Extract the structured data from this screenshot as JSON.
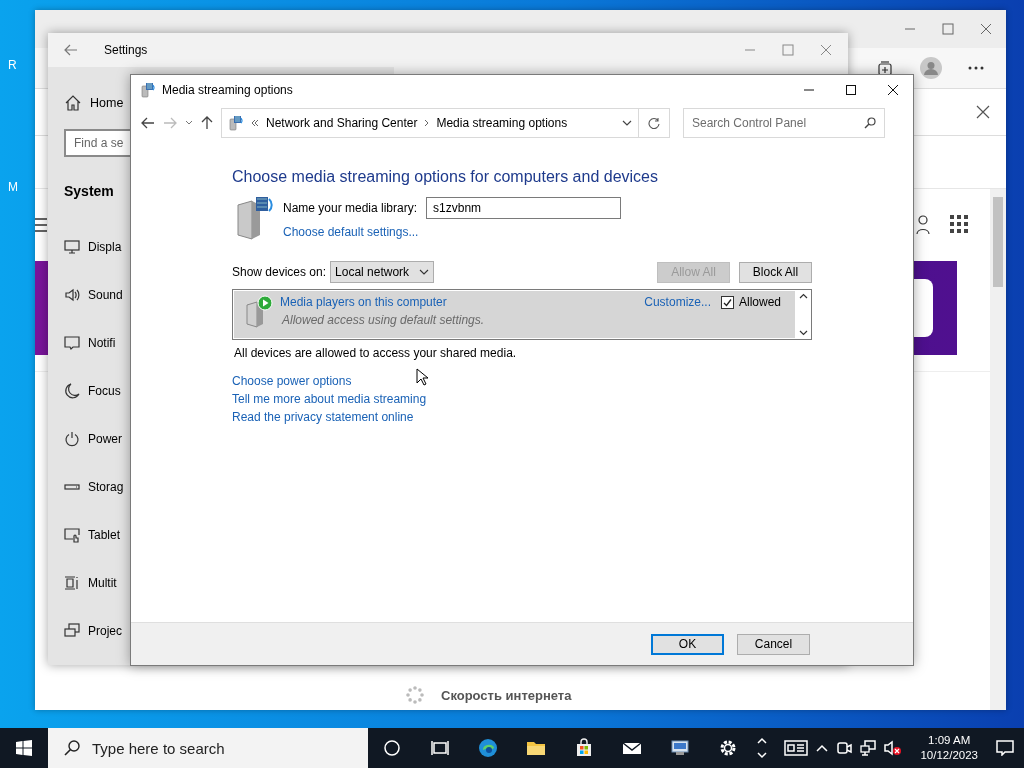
{
  "desktop": {
    "icon_labels": [
      "R",
      "M"
    ]
  },
  "browser": {
    "footer_text": "Скорость интернета"
  },
  "settings": {
    "title": "Settings",
    "home": "Home",
    "search": {
      "placeholder": "Find a se"
    },
    "section": "System",
    "items": [
      {
        "kind": "display",
        "label": "Displa"
      },
      {
        "kind": "sound",
        "label": "Sound"
      },
      {
        "kind": "notifications",
        "label": "Notifi"
      },
      {
        "kind": "focus",
        "label": "Focus"
      },
      {
        "kind": "power",
        "label": "Power"
      },
      {
        "kind": "storage",
        "label": "Storag"
      },
      {
        "kind": "tablet",
        "label": "Tablet"
      },
      {
        "kind": "multitasking",
        "label": "Multit"
      },
      {
        "kind": "projecting",
        "label": "Projec"
      }
    ]
  },
  "dialog": {
    "title": "Media streaming options",
    "breadcrumb": [
      "Network and Sharing Center",
      "Media streaming options"
    ],
    "search": {
      "placeholder": "Search Control Panel"
    },
    "heading": "Choose media streaming options for computers and devices",
    "library_label": "Name your media library:",
    "library_name": "s1zvbnm",
    "default_link": "Choose default settings...",
    "show_devices_label": "Show devices on:",
    "show_devices_value": "Local network",
    "actions": [
      {
        "label": "Allow All",
        "disabled": true
      },
      {
        "label": "Block All",
        "disabled": false
      }
    ],
    "devices": [
      {
        "name": "Media players on this computer",
        "status": "Allowed access using default settings.",
        "customize": "Customize...",
        "allowed_label": "Allowed",
        "checked": true,
        "selected": true
      }
    ],
    "summary": "All devices are allowed to access your shared media.",
    "links": [
      "Choose power options",
      "Tell me more about media streaming",
      "Read the privacy statement online"
    ],
    "buttons": [
      {
        "label": "OK",
        "default": true
      },
      {
        "label": "Cancel",
        "default": false
      }
    ]
  },
  "taskbar": {
    "search_placeholder": "Type here to search",
    "time": "1:09 AM",
    "date": "10/12/2023"
  }
}
